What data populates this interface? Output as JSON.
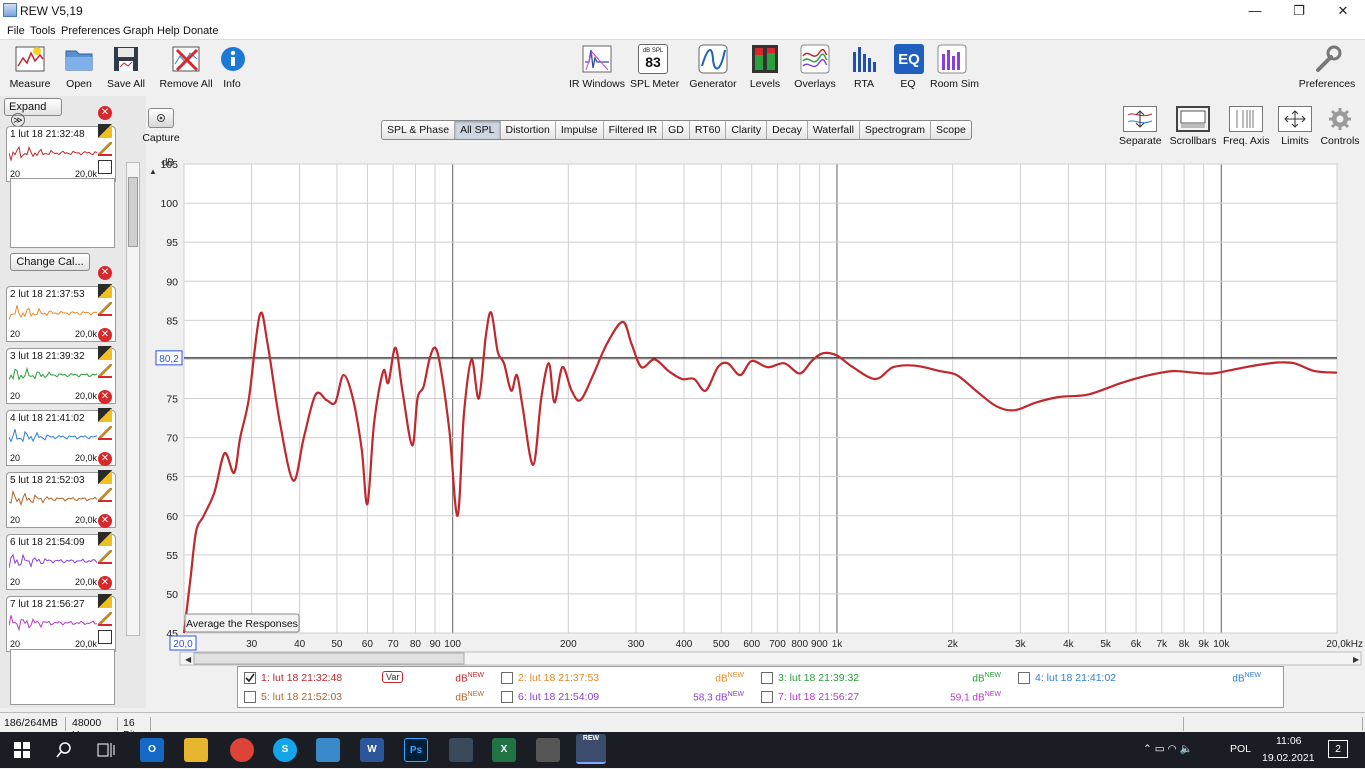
{
  "window": {
    "title": "REW V5,19",
    "minimize_glyph": "—",
    "restore_glyph": "❐",
    "close_glyph": "✕"
  },
  "menu": [
    "File",
    "Tools",
    "Preferences",
    "Graph",
    "Help",
    "Donate"
  ],
  "toolbar": {
    "left": [
      {
        "label": "Measure",
        "icon": "measure-icon"
      },
      {
        "label": "Open",
        "icon": "folder-icon"
      },
      {
        "label": "Save All",
        "icon": "save-icon"
      },
      {
        "label": "Remove All",
        "icon": "remove-icon"
      },
      {
        "label": "Info",
        "icon": "info-icon"
      }
    ],
    "center": [
      {
        "label": "IR Windows",
        "icon": "ir-windows-icon"
      },
      {
        "label": "SPL Meter",
        "icon": "spl-meter-icon",
        "badge_top": "dB SPL",
        "badge_value": "83"
      },
      {
        "label": "Generator",
        "icon": "generator-icon"
      },
      {
        "label": "Levels",
        "icon": "levels-icon"
      },
      {
        "label": "Overlays",
        "icon": "overlays-icon"
      },
      {
        "label": "RTA",
        "icon": "rta-icon"
      },
      {
        "label": "EQ",
        "icon": "eq-icon",
        "badge_value": "EQ"
      },
      {
        "label": "Room Sim",
        "icon": "room-sim-icon"
      }
    ],
    "preferences": {
      "label": "Preferences",
      "icon": "wrench-icon"
    }
  },
  "left_panel": {
    "expand_label": "Expand",
    "expand_glyph": "≫",
    "change_cal_label": "Change Cal...",
    "freq_min": "20",
    "freq_max": "20,0k",
    "measurements": [
      {
        "label": "1 lut 18 21:32:48",
        "color": "#c0282d"
      },
      {
        "label": "2 lut 18 21:37:53",
        "color": "#e8892a"
      },
      {
        "label": "3 lut 18 21:39:32",
        "color": "#2aa03a"
      },
      {
        "label": "4 lut 18 21:41:02",
        "color": "#2f7fd6"
      },
      {
        "label": "5 lut 18 21:52:03",
        "color": "#b2642a"
      },
      {
        "label": "6 lut 18 21:54:09",
        "color": "#8a3fd8"
      },
      {
        "label": "7 lut 18 21:56:27",
        "color": "#b838c8"
      }
    ]
  },
  "graph_tabs": [
    "SPL & Phase",
    "All SPL",
    "Distortion",
    "Impulse",
    "Filtered IR",
    "GD",
    "RT60",
    "Clarity",
    "Decay",
    "Waterfall",
    "Spectrogram",
    "Scope"
  ],
  "active_tab": "All SPL",
  "capture_label": "Capture",
  "right_tools": [
    {
      "label": "Separate",
      "icon": "separate-icon"
    },
    {
      "label": "Scrollbars",
      "icon": "scrollbars-icon"
    },
    {
      "label": "Freq. Axis",
      "icon": "freq-axis-icon"
    },
    {
      "label": "Limits",
      "icon": "limits-icon"
    },
    {
      "label": "Controls",
      "icon": "gear-icon"
    }
  ],
  "average_button_label": "Average the Responses",
  "chart_data": {
    "type": "line",
    "ylabel": "dB",
    "ylim": [
      45,
      105
    ],
    "yticks": [
      45,
      50,
      55,
      60,
      65,
      70,
      75,
      80,
      85,
      90,
      95,
      100,
      105
    ],
    "xscale": "log",
    "xlim": [
      20,
      20000
    ],
    "xtick_labels": [
      {
        "v": 30,
        "t": "30"
      },
      {
        "v": 40,
        "t": "40"
      },
      {
        "v": 50,
        "t": "50"
      },
      {
        "v": 60,
        "t": "60"
      },
      {
        "v": 70,
        "t": "70"
      },
      {
        "v": 80,
        "t": "80"
      },
      {
        "v": 90,
        "t": "90"
      },
      {
        "v": 100,
        "t": "100"
      },
      {
        "v": 200,
        "t": "200"
      },
      {
        "v": 300,
        "t": "300"
      },
      {
        "v": 400,
        "t": "400"
      },
      {
        "v": 500,
        "t": "500"
      },
      {
        "v": 600,
        "t": "600"
      },
      {
        "v": 700,
        "t": "700"
      },
      {
        "v": 800,
        "t": "800"
      },
      {
        "v": 900,
        "t": "900"
      },
      {
        "v": 1000,
        "t": "1k"
      },
      {
        "v": 2000,
        "t": "2k"
      },
      {
        "v": 3000,
        "t": "3k"
      },
      {
        "v": 4000,
        "t": "4k"
      },
      {
        "v": 5000,
        "t": "5k"
      },
      {
        "v": 6000,
        "t": "6k"
      },
      {
        "v": 7000,
        "t": "7k"
      },
      {
        "v": 8000,
        "t": "8k"
      },
      {
        "v": 9000,
        "t": "9k"
      },
      {
        "v": 10000,
        "t": "10k"
      }
    ],
    "x_start_label": "20,0",
    "x_end_label": "20,0kHz",
    "reference_level": 80.2,
    "reference_label": "80,2",
    "series": [
      {
        "color": "#c0282d",
        "points": [
          [
            20,
            45
          ],
          [
            20.8,
            52
          ],
          [
            21.5,
            58
          ],
          [
            22.5,
            60
          ],
          [
            24,
            63
          ],
          [
            25.5,
            68
          ],
          [
            27,
            65.5
          ],
          [
            28,
            70
          ],
          [
            29.5,
            75
          ],
          [
            31.5,
            85.7
          ],
          [
            33,
            82
          ],
          [
            35.5,
            72
          ],
          [
            38.5,
            64.5
          ],
          [
            41,
            70
          ],
          [
            44,
            75.5
          ],
          [
            47,
            74.8
          ],
          [
            49.5,
            74.5
          ],
          [
            52,
            78
          ],
          [
            55,
            75
          ],
          [
            58,
            68.5
          ],
          [
            60,
            61.5
          ],
          [
            62.5,
            72
          ],
          [
            66,
            78.5
          ],
          [
            68,
            77
          ],
          [
            71,
            81.5
          ],
          [
            74,
            76
          ],
          [
            78.5,
            69
          ],
          [
            81,
            75
          ],
          [
            84,
            76.5
          ],
          [
            87,
            80
          ],
          [
            90,
            81.5
          ],
          [
            93,
            79
          ],
          [
            98,
            71
          ],
          [
            103,
            60
          ],
          [
            107,
            73
          ],
          [
            112,
            80
          ],
          [
            117,
            75
          ],
          [
            122,
            83
          ],
          [
            126,
            86
          ],
          [
            131,
            81
          ],
          [
            136,
            79.5
          ],
          [
            142,
            76
          ],
          [
            147,
            78
          ],
          [
            152,
            74
          ],
          [
            162,
            66.5
          ],
          [
            170,
            75
          ],
          [
            178,
            79.5
          ],
          [
            184,
            74.5
          ],
          [
            193,
            79
          ],
          [
            204,
            76
          ],
          [
            215,
            74.8
          ],
          [
            232,
            78
          ],
          [
            252,
            82
          ],
          [
            277,
            84.8
          ],
          [
            292,
            82
          ],
          [
            310,
            79
          ],
          [
            335,
            80
          ],
          [
            365,
            78.5
          ],
          [
            395,
            77.5
          ],
          [
            425,
            77.5
          ],
          [
            455,
            76
          ],
          [
            490,
            79
          ],
          [
            520,
            79.5
          ],
          [
            560,
            78
          ],
          [
            600,
            79.8
          ],
          [
            660,
            79
          ],
          [
            730,
            79.5
          ],
          [
            800,
            78.2
          ],
          [
            860,
            79.8
          ],
          [
            920,
            80.8
          ],
          [
            1000,
            80.5
          ],
          [
            1100,
            79
          ],
          [
            1260,
            77.5
          ],
          [
            1400,
            79
          ],
          [
            1600,
            79.2
          ],
          [
            1850,
            78.5
          ],
          [
            2050,
            78
          ],
          [
            2300,
            76
          ],
          [
            2600,
            74
          ],
          [
            2900,
            73.5
          ],
          [
            3300,
            74.5
          ],
          [
            3800,
            75.2
          ],
          [
            4500,
            75.5
          ],
          [
            5500,
            77
          ],
          [
            6500,
            78
          ],
          [
            7500,
            78.5
          ],
          [
            8500,
            78.3
          ],
          [
            9500,
            78.2
          ],
          [
            11000,
            78.8
          ],
          [
            12500,
            79.3
          ],
          [
            14000,
            79.6
          ],
          [
            15500,
            79.5
          ],
          [
            17500,
            78.5
          ],
          [
            20000,
            78.3
          ]
        ]
      }
    ]
  },
  "legend": [
    {
      "label": "1: lut 18 21:32:48",
      "color": "#c0282d",
      "checked": true,
      "var": "Var",
      "value": "",
      "unit": "dB",
      "sup": "NEW"
    },
    {
      "label": "2: lut 18 21:37:53",
      "color": "#e8892a",
      "checked": false,
      "value": "",
      "unit": "dB",
      "sup": "NEW"
    },
    {
      "label": "3: lut 18 21:39:32",
      "color": "#2aa03a",
      "checked": false,
      "value": "",
      "unit": "dB",
      "sup": "NEW"
    },
    {
      "label": "4: lut 18 21:41:02",
      "color": "#2f7fd6",
      "checked": false,
      "value": "",
      "unit": "dB",
      "sup": "NEW"
    },
    {
      "label": "5: lut 18 21:52:03",
      "color": "#b2642a",
      "checked": false,
      "value": "",
      "unit": "dB",
      "sup": "NEW"
    },
    {
      "label": "6: lut 18 21:54:09",
      "color": "#8a3fd8",
      "checked": false,
      "value": "58,3",
      "unit": "dB",
      "sup": "NEW"
    },
    {
      "label": "7: lut 18 21:56:27",
      "color": "#b838c8",
      "checked": false,
      "value": "59,1",
      "unit": "dB",
      "sup": "NEW"
    }
  ],
  "status": {
    "memory": "186/264MB",
    "rate": "48000 Hz",
    "bits": "16 Bit"
  },
  "taskbar": {
    "apps": [
      "start-icon",
      "search-icon",
      "task-view-icon",
      "outlook-icon",
      "file-explorer-icon",
      "chrome-icon",
      "skype-icon",
      "notes-icon",
      "word-icon",
      "photoshop-icon",
      "save-app-icon",
      "excel-icon",
      "calculator-icon",
      "rew-icon"
    ],
    "lang": "POL",
    "time": "11:06",
    "date": "19.02.2021",
    "notif_count": "2"
  }
}
